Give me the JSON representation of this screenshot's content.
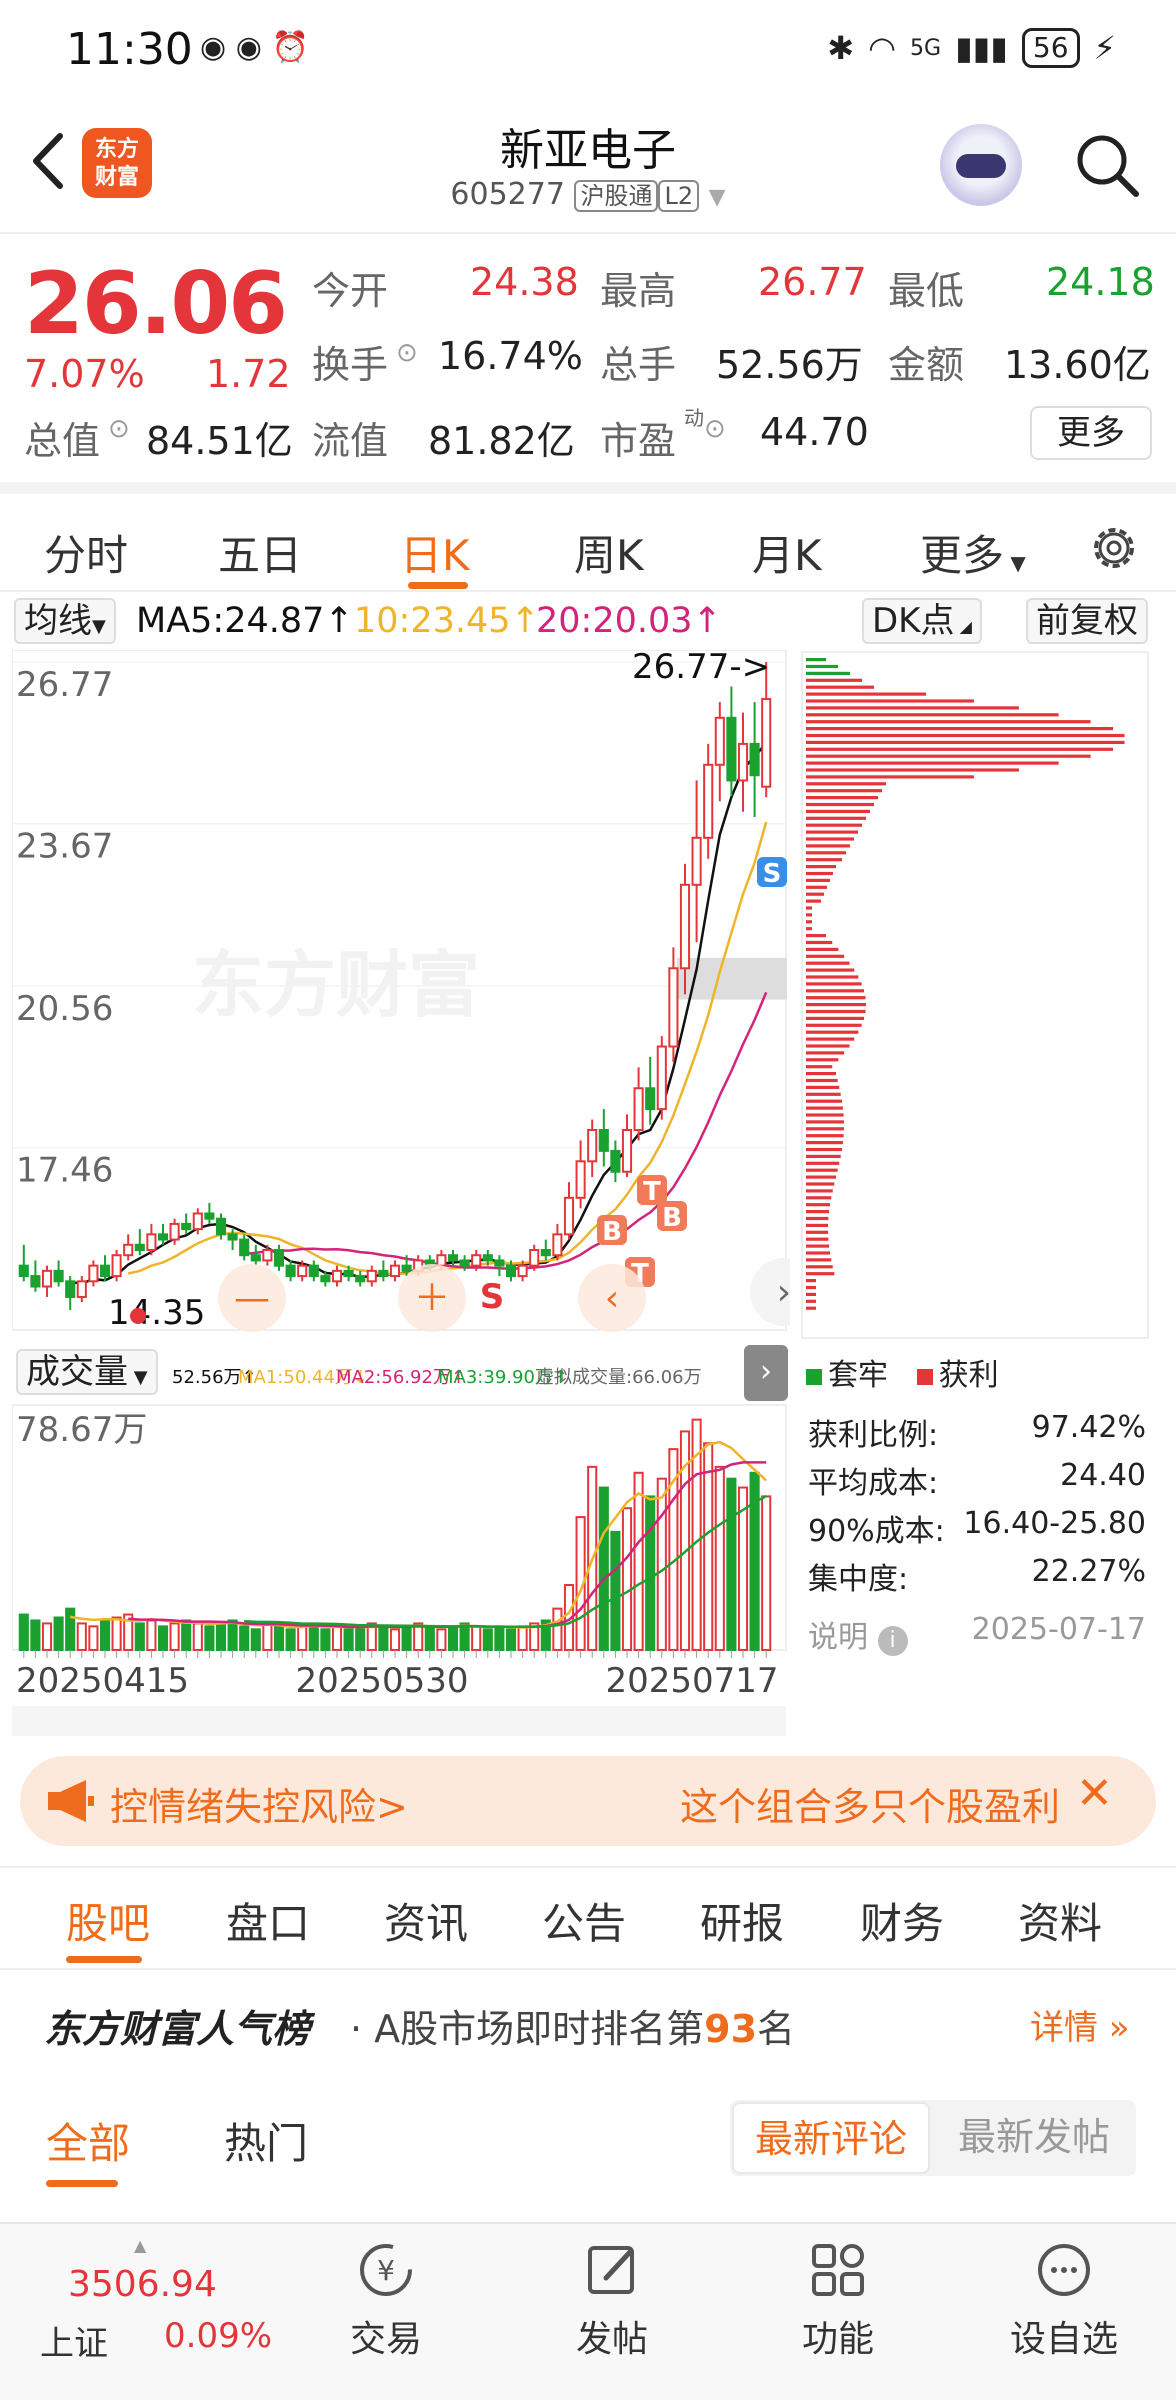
{
  "status_bar": {
    "time": "11:30",
    "battery": "56",
    "network": "5G"
  },
  "header": {
    "title": "新亚电子",
    "code": "605277",
    "tag1": "沪股通",
    "tag2": "L2",
    "logo_line1": "东方",
    "logo_line2": "财富"
  },
  "quote": {
    "price": "26.06",
    "change_pct": "7.07%",
    "change": "1.72",
    "open_label": "今开",
    "open": "24.38",
    "high_label": "最高",
    "high": "26.77",
    "low_label": "最低",
    "low": "24.18",
    "turnover_label": "换手",
    "turnover": "16.74%",
    "volume_label": "总手",
    "volume": "52.56万",
    "amount_label": "金额",
    "amount": "13.60亿",
    "mktcap_label": "总值",
    "mktcap": "84.51亿",
    "float_label": "流值",
    "float": "81.82亿",
    "pe_label": "市盈",
    "pe_sup": "动",
    "pe": "44.70",
    "more": "更多"
  },
  "period_tabs": [
    "分时",
    "五日",
    "日K",
    "周K",
    "月K",
    "更多"
  ],
  "period_active": "日K",
  "ma_row": {
    "selector": "均线",
    "ma5": "MA5:24.87↑",
    "ma10": "10:23.45↑",
    "ma20": "20:20.03↑",
    "dk": "DK点",
    "adjust": "前复权"
  },
  "colors": {
    "up": "#e4363a",
    "down": "#1aa130",
    "accent": "#f06c1d",
    "ma5": "#111111",
    "ma10": "#f0b429",
    "ma20": "#d4237a"
  },
  "chart_data": {
    "type": "candlestick",
    "y_ticks": [
      "26.77",
      "23.67",
      "20.56",
      "17.46"
    ],
    "y_range": [
      14.35,
      26.77
    ],
    "x_ticks": [
      "20250415",
      "20250530",
      "20250717"
    ],
    "annotations": {
      "max_label": "26.77->",
      "min_label": "14.35",
      "watermark": "东方财富"
    },
    "markers": [
      "B",
      "B",
      "T",
      "T",
      "S",
      "S"
    ],
    "candles": [
      [
        15.2,
        15.0,
        15.6,
        14.9
      ],
      [
        15.0,
        14.8,
        15.3,
        14.7
      ],
      [
        14.8,
        15.1,
        15.2,
        14.6
      ],
      [
        15.1,
        14.9,
        15.3,
        14.8
      ],
      [
        14.9,
        14.6,
        15.0,
        14.35
      ],
      [
        14.6,
        14.9,
        15.0,
        14.5
      ],
      [
        14.9,
        15.2,
        15.3,
        14.8
      ],
      [
        15.2,
        15.0,
        15.4,
        14.9
      ],
      [
        15.0,
        15.4,
        15.5,
        14.9
      ],
      [
        15.4,
        15.6,
        15.8,
        15.3
      ],
      [
        15.6,
        15.5,
        15.9,
        15.4
      ],
      [
        15.5,
        15.8,
        16.0,
        15.4
      ],
      [
        15.8,
        15.7,
        16.0,
        15.6
      ],
      [
        15.7,
        16.0,
        16.1,
        15.6
      ],
      [
        16.0,
        15.9,
        16.2,
        15.8
      ],
      [
        15.9,
        16.2,
        16.3,
        15.8
      ],
      [
        16.2,
        16.1,
        16.4,
        16.0
      ],
      [
        16.1,
        15.8,
        16.2,
        15.7
      ],
      [
        15.8,
        15.7,
        15.9,
        15.5
      ],
      [
        15.7,
        15.4,
        15.8,
        15.3
      ],
      [
        15.4,
        15.3,
        15.6,
        15.2
      ],
      [
        15.3,
        15.5,
        15.6,
        15.2
      ],
      [
        15.5,
        15.2,
        15.6,
        15.1
      ],
      [
        15.2,
        15.0,
        15.3,
        14.9
      ],
      [
        15.0,
        15.2,
        15.3,
        14.9
      ],
      [
        15.2,
        15.0,
        15.3,
        14.9
      ],
      [
        15.0,
        14.9,
        15.1,
        14.8
      ],
      [
        14.9,
        15.1,
        15.2,
        14.8
      ],
      [
        15.1,
        15.0,
        15.2,
        14.9
      ],
      [
        15.0,
        14.9,
        15.1,
        14.8
      ],
      [
        14.9,
        15.1,
        15.2,
        14.8
      ],
      [
        15.1,
        15.0,
        15.3,
        14.9
      ],
      [
        15.0,
        15.2,
        15.3,
        14.9
      ],
      [
        15.2,
        15.1,
        15.4,
        15.0
      ],
      [
        15.1,
        15.3,
        15.4,
        15.0
      ],
      [
        15.3,
        15.2,
        15.4,
        15.1
      ],
      [
        15.2,
        15.4,
        15.5,
        15.1
      ],
      [
        15.4,
        15.3,
        15.5,
        15.2
      ],
      [
        15.3,
        15.2,
        15.4,
        15.1
      ],
      [
        15.2,
        15.4,
        15.5,
        15.1
      ],
      [
        15.4,
        15.3,
        15.5,
        15.2
      ],
      [
        15.3,
        15.2,
        15.4,
        15.0
      ],
      [
        15.2,
        15.0,
        15.3,
        14.9
      ],
      [
        15.0,
        15.2,
        15.3,
        14.9
      ],
      [
        15.2,
        15.5,
        15.6,
        15.1
      ],
      [
        15.5,
        15.4,
        15.7,
        15.3
      ],
      [
        15.4,
        15.8,
        16.0,
        15.3
      ],
      [
        15.8,
        16.5,
        16.8,
        15.7
      ],
      [
        16.5,
        17.2,
        17.6,
        16.3
      ],
      [
        17.2,
        17.8,
        18.0,
        16.9
      ],
      [
        17.8,
        17.4,
        18.2,
        17.1
      ],
      [
        17.4,
        17.0,
        17.6,
        16.8
      ],
      [
        17.0,
        17.8,
        18.1,
        16.9
      ],
      [
        17.8,
        18.6,
        19.0,
        17.6
      ],
      [
        18.6,
        18.2,
        19.2,
        17.9
      ],
      [
        18.2,
        19.4,
        19.6,
        18.0
      ],
      [
        19.4,
        20.9,
        21.3,
        19.1
      ],
      [
        20.9,
        22.5,
        22.9,
        20.4
      ],
      [
        22.5,
        23.4,
        24.5,
        21.4
      ],
      [
        23.4,
        24.8,
        25.2,
        23.0
      ],
      [
        24.8,
        25.7,
        26.0,
        24.1
      ],
      [
        25.7,
        24.5,
        26.3,
        24.2
      ],
      [
        24.5,
        25.2,
        25.8,
        23.9
      ],
      [
        25.2,
        24.6,
        26.0,
        23.8
      ],
      [
        24.38,
        26.06,
        26.77,
        24.18
      ]
    ],
    "volume_label": "成交量",
    "volume_max": "78.67万",
    "volume_ma": [
      "52.56万↑",
      "MA1:50.44万↓",
      "MA2:56.92万↑",
      "MA3:39.90万↑",
      "虚拟成交量:66.06万"
    ],
    "volumes": [
      12,
      10,
      9,
      11,
      14,
      9,
      8,
      10,
      11,
      12,
      9,
      10,
      8,
      9,
      10,
      9,
      8,
      9,
      10,
      8,
      7,
      9,
      8,
      7,
      8,
      9,
      7,
      8,
      7,
      8,
      9,
      8,
      7,
      8,
      9,
      8,
      7,
      8,
      9,
      8,
      7,
      8,
      7,
      8,
      9,
      10,
      14,
      22,
      45,
      62,
      55,
      40,
      48,
      60,
      52,
      58,
      68,
      74,
      78,
      70,
      62,
      58,
      55,
      60,
      52
    ]
  },
  "chip": {
    "legend_trap": "套牢",
    "legend_profit": "获利",
    "rows": [
      {
        "label": "获利比例:",
        "value": "97.42%"
      },
      {
        "label": "平均成本:",
        "value": "24.40"
      },
      {
        "label": "90%成本:",
        "value": "16.40-25.80"
      },
      {
        "label": "集中度:",
        "value": "22.27%"
      }
    ],
    "note_label": "说明",
    "date": "2025-07-17"
  },
  "banner": {
    "left": "控情绪失控风险>",
    "right": "这个组合多只个股盈利"
  },
  "section_tabs": [
    "股吧",
    "盘口",
    "资讯",
    "公告",
    "研报",
    "财务",
    "资料"
  ],
  "rank": {
    "brand": "东方财富人气榜",
    "text_pre": "· A股市场即时排名第",
    "rank": "93",
    "text_post": "名",
    "detail": "详情 »"
  },
  "filter": {
    "tab_all": "全部",
    "tab_hot": "热门",
    "latest_comment": "最新评论",
    "latest_post": "最新发帖"
  },
  "bottom_nav": {
    "index_value": "3506.94",
    "index_name": "上证",
    "index_change": "0.09%",
    "items": [
      {
        "label": "交易"
      },
      {
        "label": "发帖"
      },
      {
        "label": "功能"
      },
      {
        "label": "设自选"
      }
    ]
  }
}
